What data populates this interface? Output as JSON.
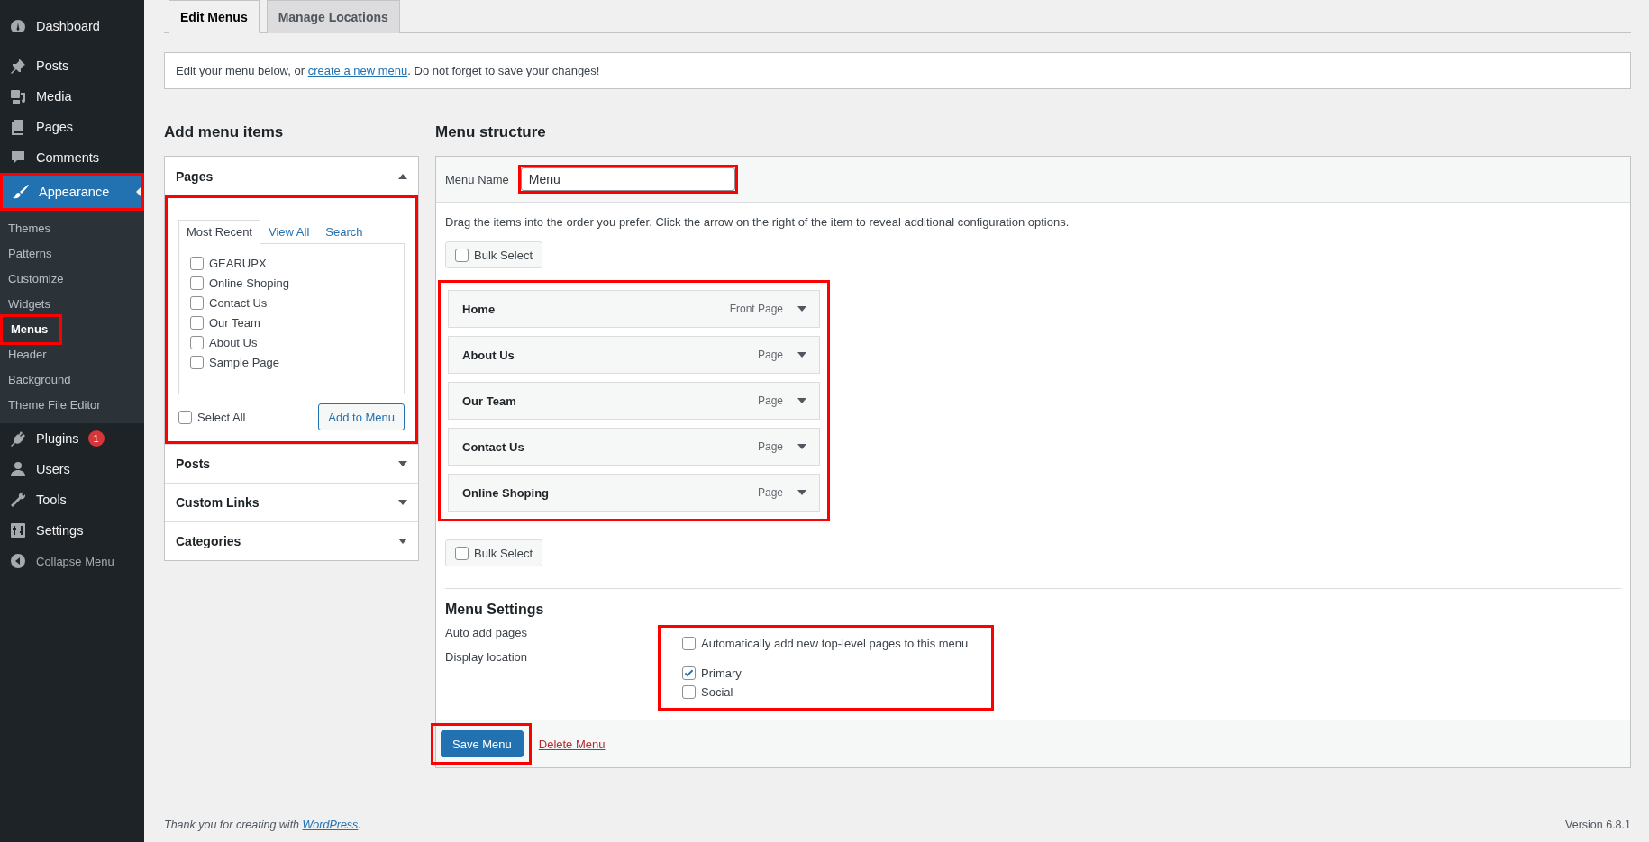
{
  "sidebar": {
    "items": [
      {
        "label": "Dashboard",
        "selected": false,
        "highlighted": false
      },
      {
        "label": "Posts",
        "selected": false,
        "highlighted": false
      },
      {
        "label": "Media",
        "selected": false,
        "highlighted": false
      },
      {
        "label": "Pages",
        "selected": false,
        "highlighted": false
      },
      {
        "label": "Comments",
        "selected": false,
        "highlighted": false
      },
      {
        "label": "Appearance",
        "selected": true,
        "highlighted": true,
        "children": [
          {
            "label": "Themes",
            "selected": false,
            "highlighted": false
          },
          {
            "label": "Patterns",
            "selected": false,
            "highlighted": false
          },
          {
            "label": "Customize",
            "selected": false,
            "highlighted": false
          },
          {
            "label": "Widgets",
            "selected": false,
            "highlighted": false
          },
          {
            "label": "Menus",
            "selected": true,
            "highlighted": true
          },
          {
            "label": "Header",
            "selected": false,
            "highlighted": false
          },
          {
            "label": "Background",
            "selected": false,
            "highlighted": false
          },
          {
            "label": "Theme File Editor",
            "selected": false,
            "highlighted": false
          }
        ]
      },
      {
        "label": "Plugins",
        "selected": false,
        "highlighted": false,
        "badge": "1"
      },
      {
        "label": "Users",
        "selected": false,
        "highlighted": false
      },
      {
        "label": "Tools",
        "selected": false,
        "highlighted": false
      },
      {
        "label": "Settings",
        "selected": false,
        "highlighted": false
      }
    ],
    "collapse": "Collapse Menu"
  },
  "tabs": [
    {
      "label": "Edit Menus",
      "selected": true
    },
    {
      "label": "Manage Locations",
      "selected": false
    }
  ],
  "notice": {
    "before": "Edit your menu below, or ",
    "link": "create a new menu",
    "after": ". Do not forget to save your changes!"
  },
  "add_items": {
    "title": "Add menu items",
    "sections": [
      {
        "title": "Pages",
        "expanded": true,
        "highlighted": true,
        "tabs": [
          {
            "label": "Most Recent",
            "selected": true
          },
          {
            "label": "View All",
            "selected": false
          },
          {
            "label": "Search",
            "selected": false
          }
        ],
        "items": [
          {
            "label": "GEARUPX",
            "checked": false
          },
          {
            "label": "Online Shoping",
            "checked": false
          },
          {
            "label": "Contact Us",
            "checked": false
          },
          {
            "label": "Our Team",
            "checked": false
          },
          {
            "label": "About Us",
            "checked": false
          },
          {
            "label": "Sample Page",
            "checked": false
          }
        ],
        "select_all": {
          "label": "Select All",
          "checked": false
        },
        "add_button": "Add to Menu"
      },
      {
        "title": "Posts",
        "expanded": false
      },
      {
        "title": "Custom Links",
        "expanded": false
      },
      {
        "title": "Categories",
        "expanded": false
      }
    ]
  },
  "menu_structure": {
    "title": "Menu structure",
    "name_label": "Menu Name",
    "name_value": "Menu",
    "name_highlighted": true,
    "instructions": "Drag the items into the order you prefer. Click the arrow on the right of the item to reveal additional configuration options.",
    "bulk_select_top": {
      "label": "Bulk Select",
      "checked": false
    },
    "items_highlighted": true,
    "items": [
      {
        "title": "Home",
        "type": "Front Page"
      },
      {
        "title": "About Us",
        "type": "Page"
      },
      {
        "title": "Our Team",
        "type": "Page"
      },
      {
        "title": "Contact Us",
        "type": "Page"
      },
      {
        "title": "Online Shoping",
        "type": "Page"
      }
    ],
    "bulk_select_bottom": {
      "label": "Bulk Select",
      "checked": false
    },
    "settings": {
      "title": "Menu Settings",
      "highlighted": true,
      "auto_add_label": "Auto add pages",
      "auto_add": {
        "label": "Automatically add new top-level pages to this menu",
        "checked": false
      },
      "display_label": "Display location",
      "locations": [
        {
          "label": "Primary",
          "checked": true
        },
        {
          "label": "Social",
          "checked": false
        }
      ]
    },
    "save_button": "Save Menu",
    "save_highlighted": true,
    "delete_link": "Delete Menu"
  },
  "footer": {
    "before": "Thank you for creating with ",
    "link": "WordPress",
    "after": ".",
    "version": "Version 6.8.1"
  }
}
